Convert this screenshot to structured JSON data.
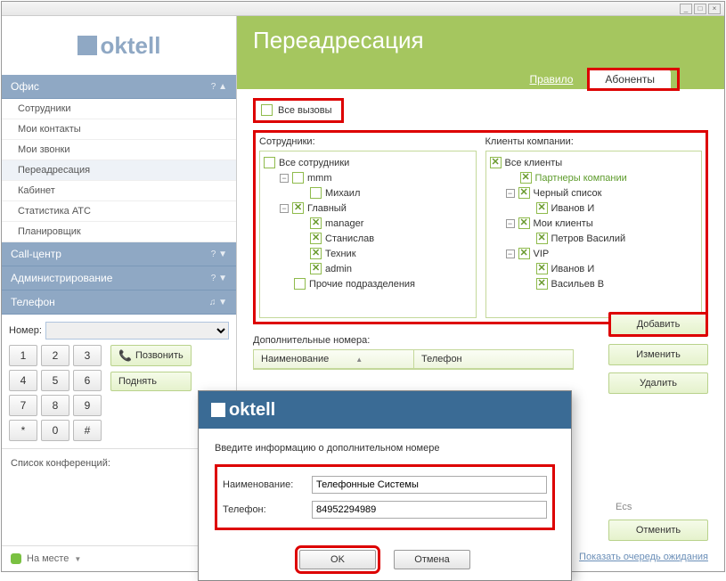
{
  "titlebar": {
    "min": "_",
    "max": "□",
    "close": "×"
  },
  "logo": "oktell",
  "sidebar": {
    "sections": [
      {
        "label": "Офис",
        "items": [
          "Сотрудники",
          "Мои контакты",
          "Мои звонки",
          "Переадресация",
          "Кабинет",
          "Статистика АТС",
          "Планировщик"
        ],
        "active_index": 3,
        "expanded": true
      },
      {
        "label": "Call-центр",
        "items": [],
        "expanded": false
      },
      {
        "label": "Администрирование",
        "items": [],
        "expanded": false
      },
      {
        "label": "Телефон",
        "items": [],
        "expanded": false
      }
    ]
  },
  "dial": {
    "label": "Номер:",
    "buttons": [
      "1",
      "2",
      "3",
      "4",
      "5",
      "6",
      "7",
      "8",
      "9",
      "*",
      "0",
      "#"
    ],
    "call": "Позвонить",
    "hold": "Поднять"
  },
  "conf": {
    "label": "Список конференций:"
  },
  "status": {
    "label": "На месте"
  },
  "header": {
    "title": "Переадресация",
    "tab_rule": "Правило",
    "tab_subs": "Абоненты"
  },
  "content": {
    "all_calls": "Все вызовы",
    "employees_label": "Сотрудники:",
    "clients_label": "Клиенты компании:",
    "employees_tree": {
      "root": "Все сотрудники",
      "g1": "mmm",
      "g1_1": "Михаил",
      "g2": "Главный",
      "g2_1": "manager",
      "g2_2": "Станислав",
      "g2_3": "Техник",
      "g2_4": "admin",
      "g3": "Прочие подразделения"
    },
    "clients_tree": {
      "root": "Все клиенты",
      "c1": "Партнеры компании",
      "c2": "Черный список",
      "c2_1": "Иванов И",
      "c3": "Мои клиенты",
      "c3_1": "Петров Василий",
      "c4": "VIP",
      "c4_1": "Иванов И",
      "c4_2": "Васильев В"
    },
    "addnum_label": "Дополнительные номера:",
    "col_name": "Наименование",
    "col_phone": "Телефон",
    "btn_add": "Добавить",
    "btn_edit": "Изменить",
    "btn_del": "Удалить",
    "ecs": "Ecs",
    "btn_cancel": "Отменить",
    "queue_link": "Показать очередь ожидания"
  },
  "dialog": {
    "logo": "oktell",
    "prompt": "Введите информацию о дополнительном номере",
    "name_label": "Наименование:",
    "name_value": "Телефонные Системы",
    "phone_label": "Телефон:",
    "phone_value": "84952294989",
    "ok": "OK",
    "cancel": "Отмена"
  }
}
